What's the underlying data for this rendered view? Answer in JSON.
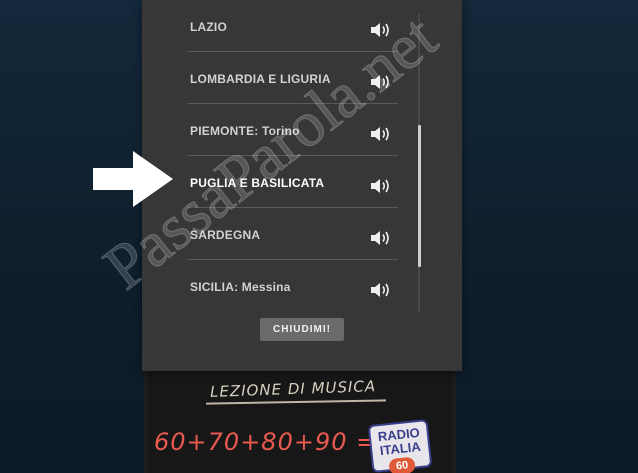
{
  "regions": [
    {
      "label": "LAZIO",
      "icon": "speaker-icon"
    },
    {
      "label": "LOMBARDIA E LIGURIA",
      "icon": "speaker-icon"
    },
    {
      "label": "PIEMONTE: Torino",
      "icon": "speaker-icon"
    },
    {
      "label": "PUGLIA E BASILICATA",
      "icon": "speaker-icon",
      "highlighted": true
    },
    {
      "label": "SARDEGNA",
      "icon": "speaker-icon"
    },
    {
      "label": "SICILIA: Messina",
      "icon": "speaker-icon"
    }
  ],
  "close_button": {
    "label": "CHIUDIMI!"
  },
  "background_board": {
    "title": "LEZIONE DI MUSICA",
    "equation": "60+70+80+90 =",
    "logo_line1": "RADIO",
    "logo_line2": "ITALIA",
    "logo_number": "60"
  },
  "watermark": "PassaParola.net",
  "colors": {
    "panel": "#373737",
    "text": "#d2d2d2",
    "button": "#6a6a6a",
    "background": "#0f1f2d"
  }
}
